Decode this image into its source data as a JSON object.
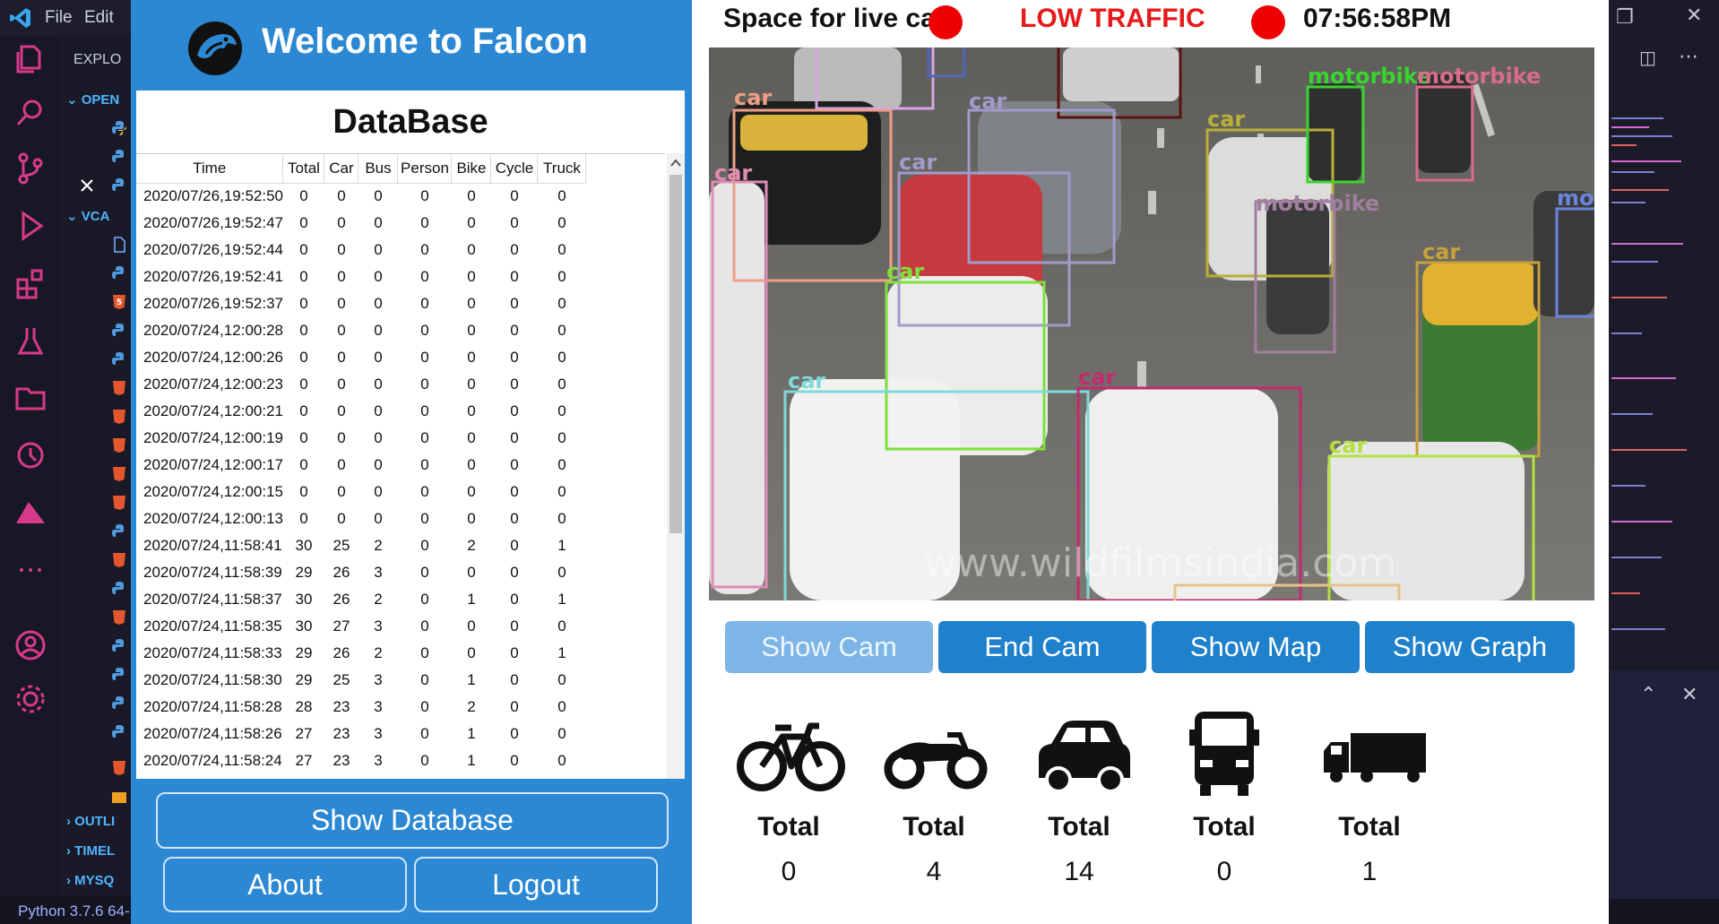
{
  "vscode": {
    "menu": [
      "File",
      "Edit"
    ],
    "explorer": {
      "header": "EXPLO",
      "sections": [
        "OPEN",
        "VCA",
        "OUTLI",
        "TIMEL",
        "MYSQ"
      ]
    },
    "status_python": "Python 3.7.6 64-"
  },
  "app": {
    "title": "Welcome to Falcon",
    "database": {
      "title": "DataBase",
      "columns": [
        "Time",
        "Total",
        "Car",
        "Bus",
        "Person",
        "Bike",
        "Cycle",
        "Truck"
      ],
      "rows": [
        [
          "2020/07/26,19:52:50",
          "0",
          "0",
          "0",
          "0",
          "0",
          "0",
          "0"
        ],
        [
          "2020/07/26,19:52:47",
          "0",
          "0",
          "0",
          "0",
          "0",
          "0",
          "0"
        ],
        [
          "2020/07/26,19:52:44",
          "0",
          "0",
          "0",
          "0",
          "0",
          "0",
          "0"
        ],
        [
          "2020/07/26,19:52:41",
          "0",
          "0",
          "0",
          "0",
          "0",
          "0",
          "0"
        ],
        [
          "2020/07/26,19:52:37",
          "0",
          "0",
          "0",
          "0",
          "0",
          "0",
          "0"
        ],
        [
          "2020/07/24,12:00:28",
          "0",
          "0",
          "0",
          "0",
          "0",
          "0",
          "0"
        ],
        [
          "2020/07/24,12:00:26",
          "0",
          "0",
          "0",
          "0",
          "0",
          "0",
          "0"
        ],
        [
          "2020/07/24,12:00:23",
          "0",
          "0",
          "0",
          "0",
          "0",
          "0",
          "0"
        ],
        [
          "2020/07/24,12:00:21",
          "0",
          "0",
          "0",
          "0",
          "0",
          "0",
          "0"
        ],
        [
          "2020/07/24,12:00:19",
          "0",
          "0",
          "0",
          "0",
          "0",
          "0",
          "0"
        ],
        [
          "2020/07/24,12:00:17",
          "0",
          "0",
          "0",
          "0",
          "0",
          "0",
          "0"
        ],
        [
          "2020/07/24,12:00:15",
          "0",
          "0",
          "0",
          "0",
          "0",
          "0",
          "0"
        ],
        [
          "2020/07/24,12:00:13",
          "0",
          "0",
          "0",
          "0",
          "0",
          "0",
          "0"
        ],
        [
          "2020/07/24,11:58:41",
          "30",
          "25",
          "2",
          "0",
          "2",
          "0",
          "1"
        ],
        [
          "2020/07/24,11:58:39",
          "29",
          "26",
          "3",
          "0",
          "0",
          "0",
          "0"
        ],
        [
          "2020/07/24,11:58:37",
          "30",
          "26",
          "2",
          "0",
          "1",
          "0",
          "1"
        ],
        [
          "2020/07/24,11:58:35",
          "30",
          "27",
          "3",
          "0",
          "0",
          "0",
          "0"
        ],
        [
          "2020/07/24,11:58:33",
          "29",
          "26",
          "2",
          "0",
          "0",
          "0",
          "1"
        ],
        [
          "2020/07/24,11:58:30",
          "29",
          "25",
          "3",
          "0",
          "1",
          "0",
          "0"
        ],
        [
          "2020/07/24,11:58:28",
          "28",
          "23",
          "3",
          "0",
          "2",
          "0",
          "0"
        ],
        [
          "2020/07/24,11:58:26",
          "27",
          "23",
          "3",
          "0",
          "1",
          "0",
          "0"
        ],
        [
          "2020/07/24,11:58:24",
          "27",
          "23",
          "3",
          "0",
          "1",
          "0",
          "0"
        ]
      ]
    },
    "buttons": {
      "show_database": "Show Database",
      "about": "About",
      "logout": "Logout",
      "show_cam": "Show Cam",
      "end_cam": "End Cam",
      "show_map": "Show Map",
      "show_graph": "Show Graph"
    },
    "live": {
      "cam_label": "Space for live cam",
      "traffic_status": "LOW TRAFFIC",
      "clock": "07:56:58PM",
      "watermark": "www.wildfilmsindia.com",
      "detections": [
        "car",
        "car",
        "car",
        "car",
        "car",
        "car",
        "car",
        "car",
        "car",
        "car",
        "motorbike",
        "motorbike",
        "motorbike",
        "moto"
      ]
    },
    "counters": [
      {
        "icon": "bicycle-icon",
        "label": "Total",
        "value": "0"
      },
      {
        "icon": "motorbike-icon",
        "label": "Total",
        "value": "4"
      },
      {
        "icon": "car-icon",
        "label": "Total",
        "value": "14"
      },
      {
        "icon": "bus-icon",
        "label": "Total",
        "value": "0"
      },
      {
        "icon": "truck-icon",
        "label": "Total",
        "value": "1"
      }
    ],
    "colors": {
      "panel_blue": "#2c88d2",
      "button_blue": "#1f80cc",
      "status_red": "#ee0000"
    }
  }
}
